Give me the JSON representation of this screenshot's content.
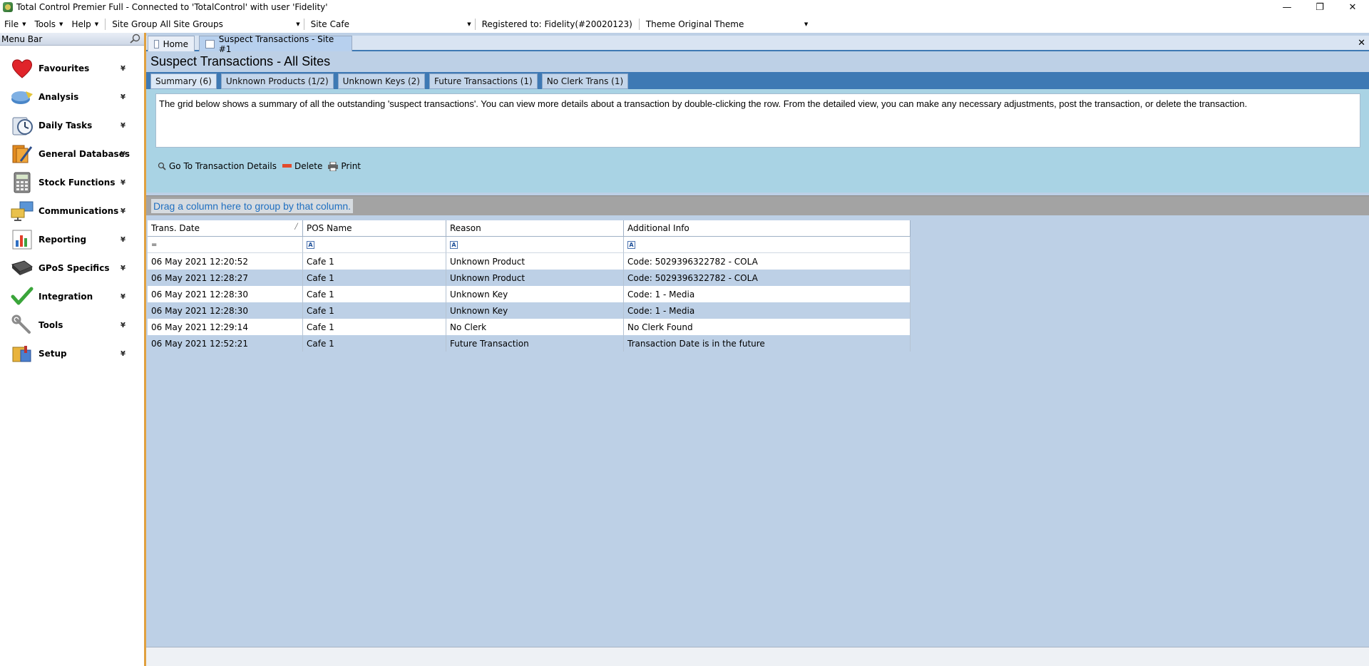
{
  "window": {
    "title": "Total Control Premier Full - Connected to 'TotalControl' with user 'Fidelity'",
    "minimize": "—",
    "restore": "❐",
    "close": "✕"
  },
  "menubar": {
    "file": "File",
    "tools": "Tools",
    "help": "Help",
    "site_group_label": "Site Group",
    "site_group_value": "All Site Groups",
    "site_label": "Site",
    "site_value": "Cafe",
    "registered": "Registered to: Fidelity(#20020123)",
    "theme_label": "Theme",
    "theme_value": "Original Theme"
  },
  "sidebar": {
    "header": "Menu Bar",
    "items": [
      {
        "label": "Favourites",
        "icon": "heart-icon"
      },
      {
        "label": "Analysis",
        "icon": "analysis-icon"
      },
      {
        "label": "Daily Tasks",
        "icon": "stopwatch-icon"
      },
      {
        "label": "General Databases",
        "icon": "databases-icon"
      },
      {
        "label": "Stock Functions",
        "icon": "calculator-icon"
      },
      {
        "label": "Communications",
        "icon": "communications-icon"
      },
      {
        "label": "Reporting",
        "icon": "report-chart-icon"
      },
      {
        "label": "GPoS Specifics",
        "icon": "chip-icon"
      },
      {
        "label": "Integration",
        "icon": "checkmark-icon"
      },
      {
        "label": "Tools",
        "icon": "wrench-icon"
      },
      {
        "label": "Setup",
        "icon": "setup-icon"
      }
    ],
    "chevron": "»"
  },
  "doc_tabs": {
    "home": "Home",
    "suspect": "Suspect Transactions - Site #1",
    "close": "✕"
  },
  "page": {
    "title": "Suspect Transactions - All Sites"
  },
  "sub_tabs": [
    "Summary (6)",
    "Unknown Products (1/2)",
    "Unknown Keys (2)",
    "Future Transactions (1)",
    "No Clerk Trans (1)"
  ],
  "info_text": "The grid below shows a summary of all the outstanding 'suspect transactions'.  You can view more details about a transaction by double-clicking the row.  From the detailed view, you can make any necessary adjustments, post the transaction, or delete the transaction.",
  "actions": {
    "details": "Go To Transaction Details",
    "delete": "Delete",
    "print": "Print"
  },
  "group_hint": "Drag a column here to group by that column.",
  "grid": {
    "columns": [
      "Trans. Date",
      "POS Name",
      "Reason",
      "Additional Info"
    ],
    "filter_eq": "=",
    "filter_a": "A",
    "rows": [
      [
        "06 May 2021 12:20:52",
        "Cafe 1",
        "Unknown Product",
        "Code: 5029396322782 - COLA"
      ],
      [
        "06 May 2021 12:28:27",
        "Cafe 1",
        "Unknown Product",
        "Code: 5029396322782 - COLA"
      ],
      [
        "06 May 2021 12:28:30",
        "Cafe 1",
        "Unknown Key",
        "Code: 1 - Media"
      ],
      [
        "06 May 2021 12:28:30",
        "Cafe 1",
        "Unknown Key",
        "Code: 1 - Media"
      ],
      [
        "06 May 2021 12:29:14",
        "Cafe 1",
        "No Clerk",
        "No Clerk Found"
      ],
      [
        "06 May 2021 12:52:21",
        "Cafe 1",
        "Future Transaction",
        "Transaction Date is in the future"
      ]
    ]
  }
}
